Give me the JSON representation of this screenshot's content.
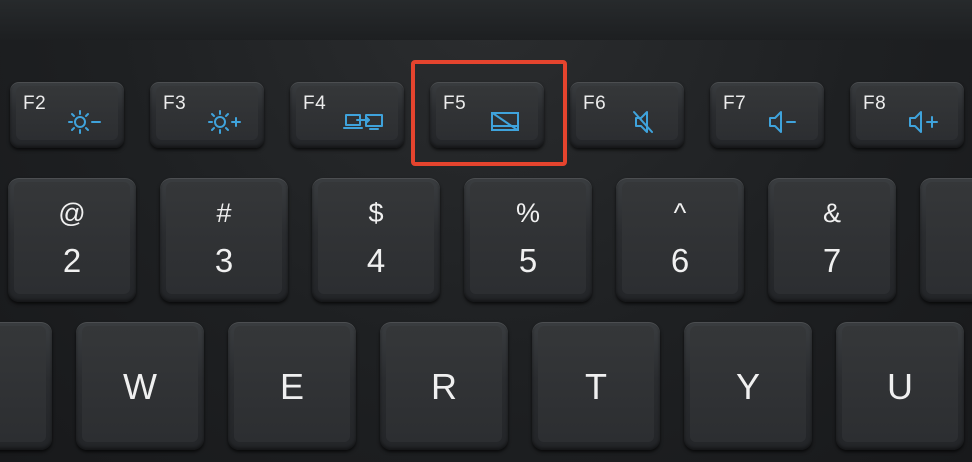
{
  "colors": {
    "highlight": "#e5442e",
    "icon_blue": "#3fa3dc",
    "key_legend": "#f0f0f0"
  },
  "function_keys": [
    {
      "label": "F2",
      "icon": "brightness-down-icon"
    },
    {
      "label": "F3",
      "icon": "brightness-up-icon"
    },
    {
      "label": "F4",
      "icon": "display-switch-icon"
    },
    {
      "label": "F5",
      "icon": "touchpad-toggle-icon"
    },
    {
      "label": "F6",
      "icon": "mute-icon"
    },
    {
      "label": "F7",
      "icon": "volume-down-icon"
    },
    {
      "label": "F8",
      "icon": "volume-up-icon"
    }
  ],
  "number_keys": [
    {
      "shift": "@",
      "main": "2"
    },
    {
      "shift": "#",
      "main": "3"
    },
    {
      "shift": "$",
      "main": "4"
    },
    {
      "shift": "%",
      "main": "5"
    },
    {
      "shift": "^",
      "main": "6"
    },
    {
      "shift": "&",
      "main": "7"
    }
  ],
  "letter_keys": [
    "W",
    "E",
    "R",
    "T",
    "Y",
    "U"
  ],
  "highlighted_key": "F5"
}
